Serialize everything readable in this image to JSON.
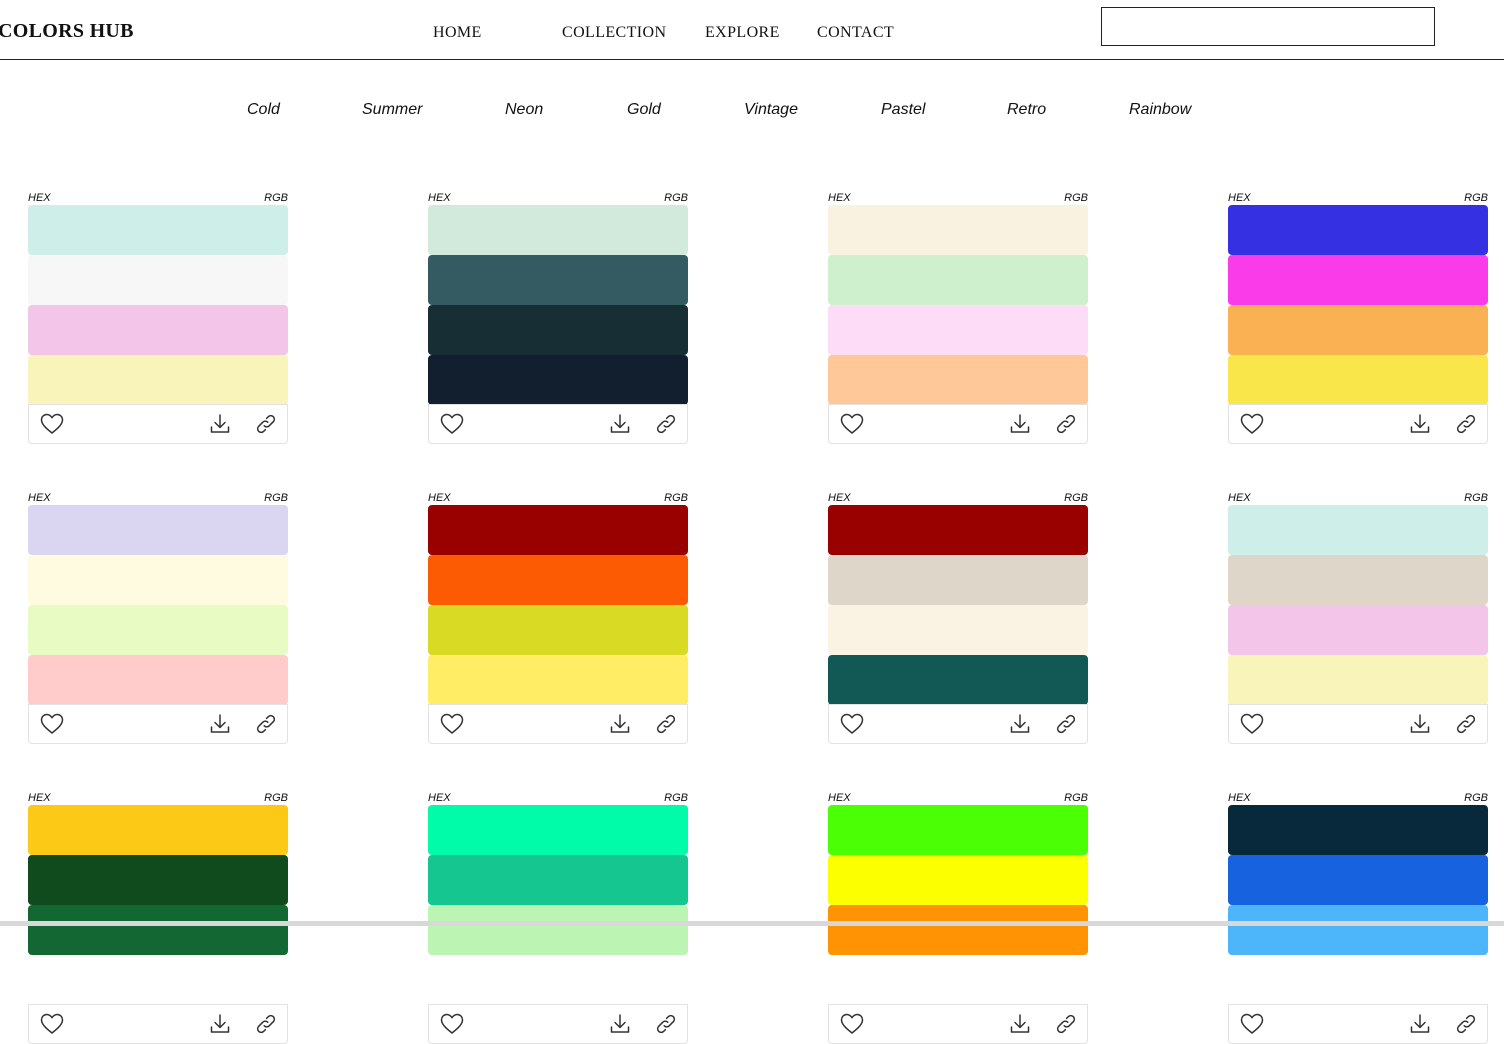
{
  "header": {
    "brand": "COLORS HUB",
    "nav": [
      "HOME",
      "COLLECTION",
      "EXPLORE",
      "CONTACT"
    ],
    "search_value": ""
  },
  "categories": [
    "Cold",
    "Summer",
    "Neon",
    "Gold",
    "Vintage",
    "Pastel",
    "Retro",
    "Rainbow"
  ],
  "card_labels": {
    "hex": "HEX",
    "rgb": "RGB"
  },
  "icons": {
    "like": "heart-icon",
    "download": "download-icon",
    "share": "link-icon"
  },
  "palettes": [
    [
      "#cdeee9",
      "#f7f7f7",
      "#f3c5e8",
      "#f9f4b9"
    ],
    [
      "#d2eadc",
      "#355b62",
      "#182e35",
      "#111f2e"
    ],
    [
      "#f9f2e0",
      "#cff0cd",
      "#fddcf7",
      "#ffc899"
    ],
    [
      "#3530e2",
      "#f93be9",
      "#fab154",
      "#f8e64a"
    ],
    [
      "#dad6f2",
      "#fefbe1",
      "#e8fbc3",
      "#ffcccb"
    ],
    [
      "#990000",
      "#fd5b03",
      "#d8da23",
      "#feed65"
    ],
    [
      "#990000",
      "#ded6c9",
      "#faf3e4",
      "#125854"
    ],
    [
      "#cdeee9",
      "#ded6c9",
      "#f3c5e8",
      "#f9f4b9"
    ],
    [
      "#fcc917",
      "#0f4b1c",
      "#136732",
      "#ffffff"
    ],
    [
      "#00fca8",
      "#15c690",
      "#bbf4b3",
      "#ffffff"
    ],
    [
      "#4bff05",
      "#fbff00",
      "#ff9304",
      "#ffffff"
    ],
    [
      "#08283c",
      "#1762de",
      "#4db6fb",
      "#ffffff"
    ]
  ]
}
